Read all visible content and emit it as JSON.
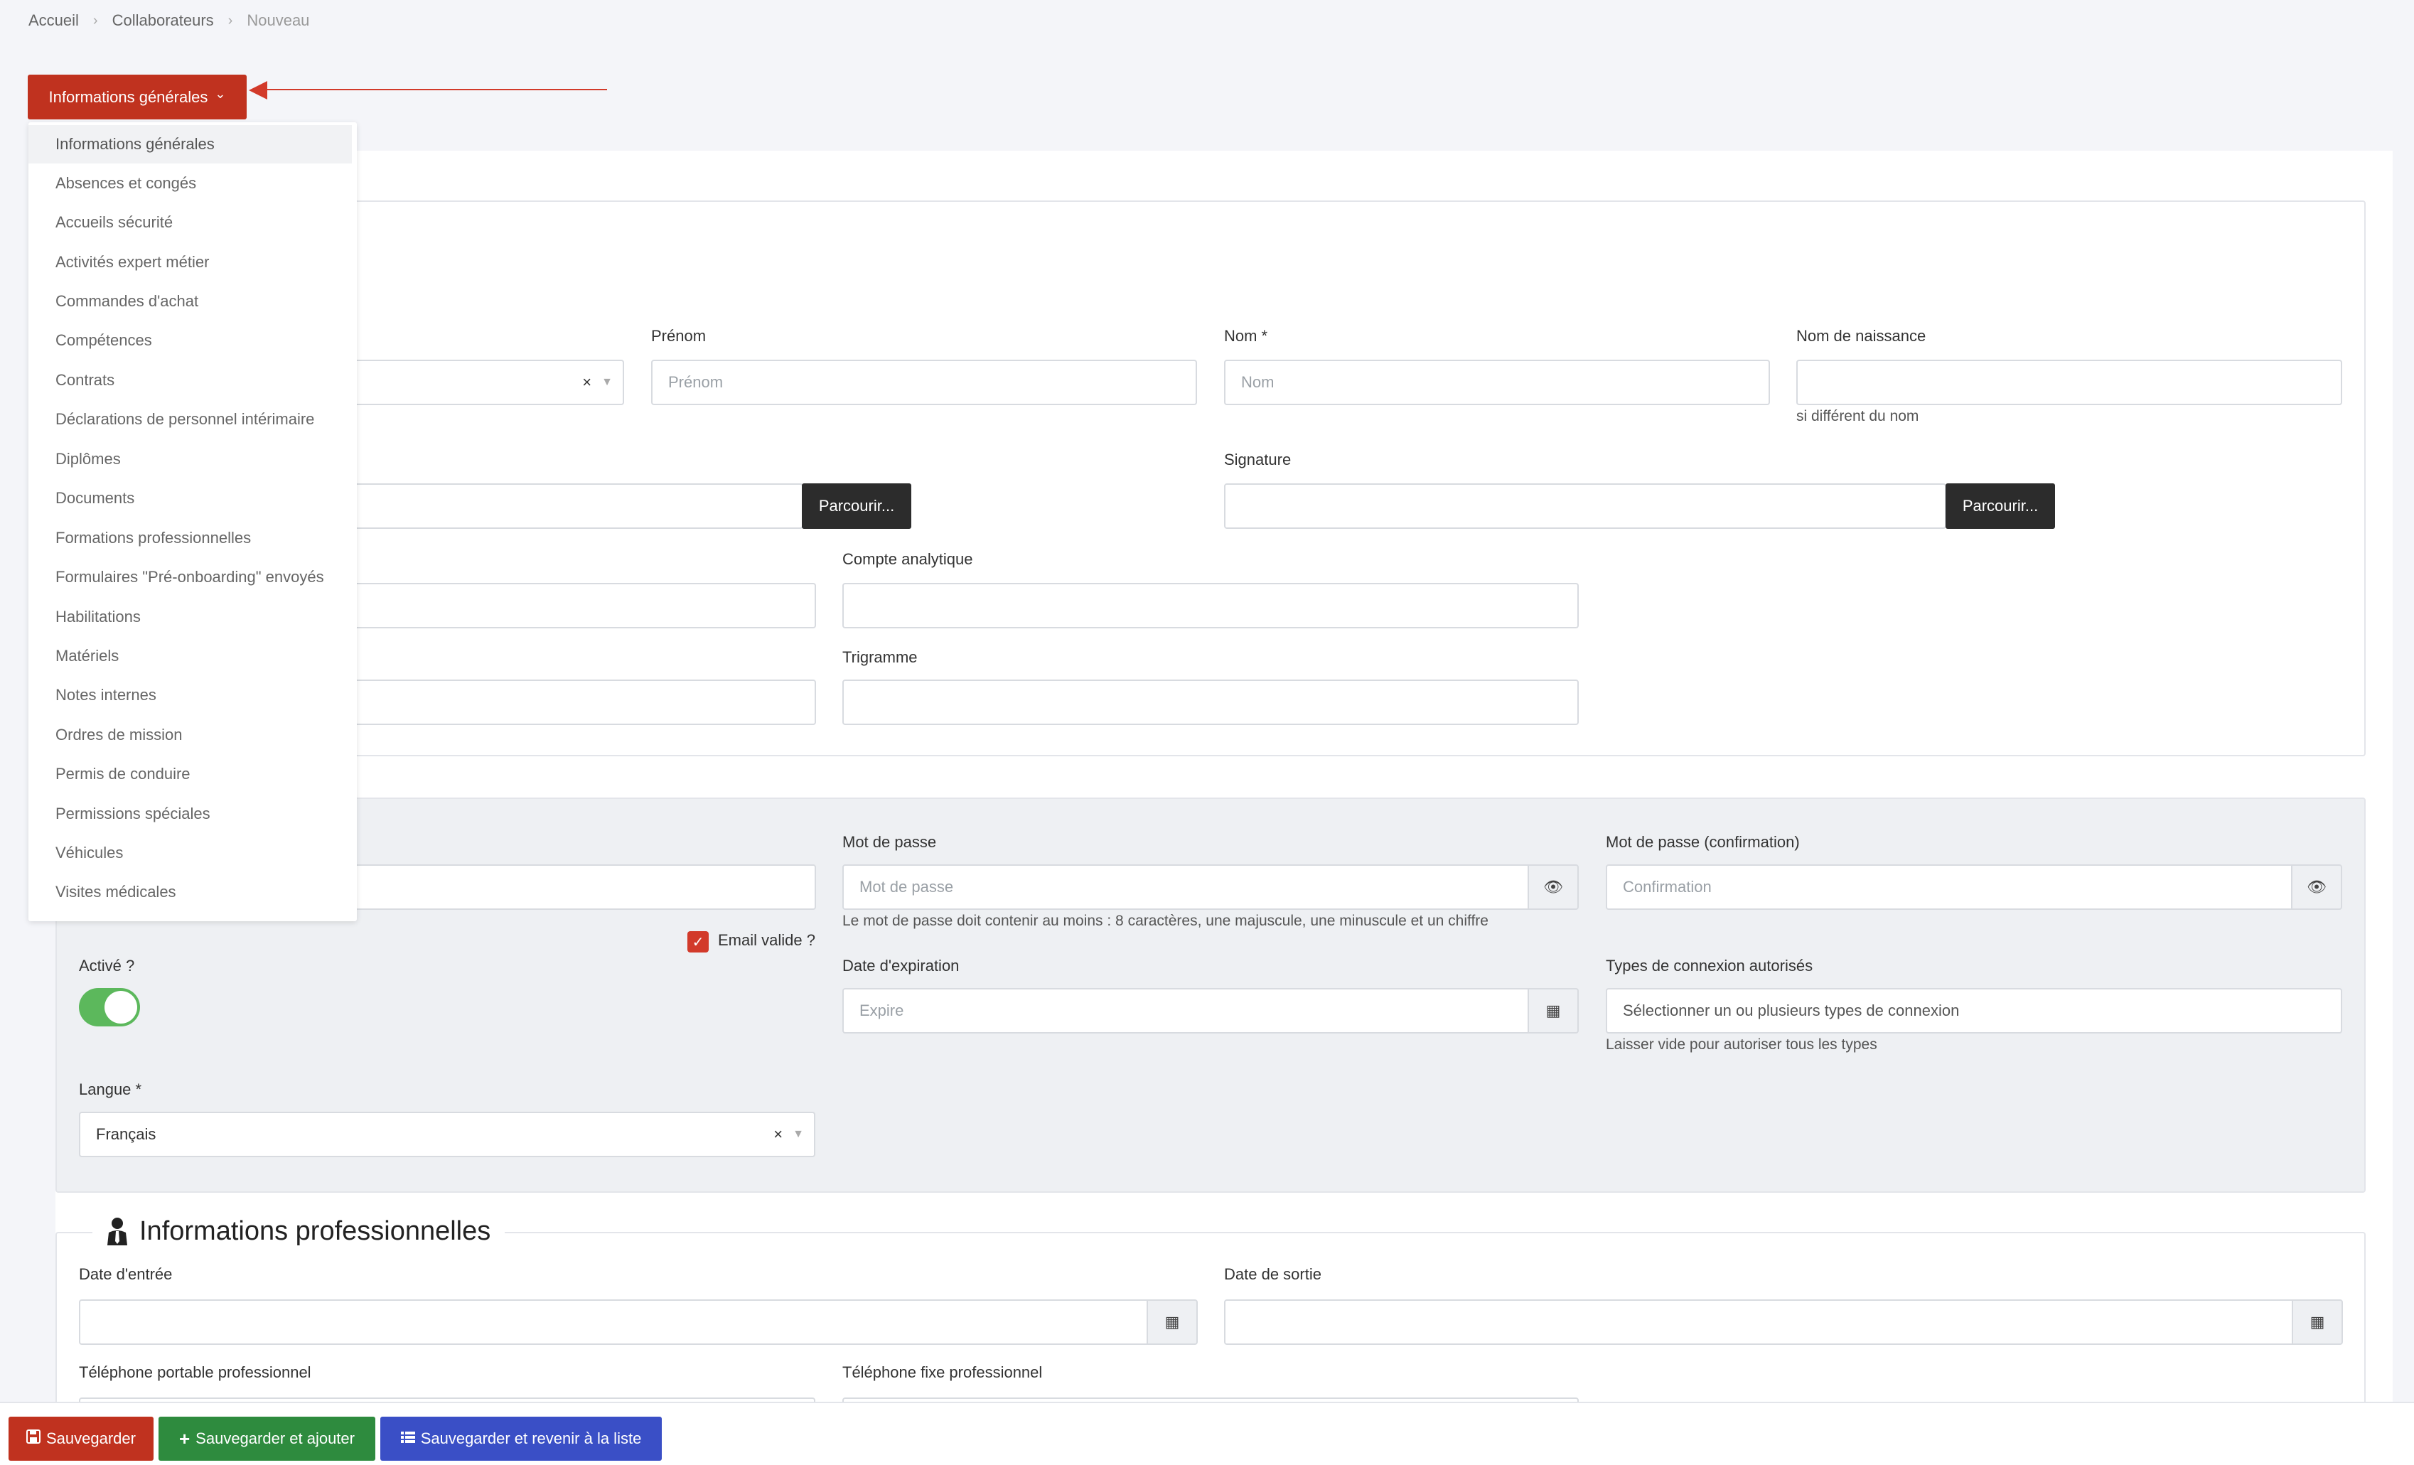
{
  "breadcrumb": {
    "items": [
      "Accueil",
      "Collaborateurs",
      "Nouveau"
    ],
    "separator": "›"
  },
  "tab_selector": {
    "label": "Informations générales",
    "chevron": "⌄"
  },
  "dropdown": {
    "items": [
      "Informations générales",
      "Absences et congés",
      "Accueils sécurité",
      "Activités expert métier",
      "Commandes d'achat",
      "Compétences",
      "Contrats",
      "Déclarations de personnel intérimaire",
      "Diplômes",
      "Documents",
      "Formations professionnelles",
      "Formulaires \"Pré-onboarding\" envoyés",
      "Habilitations",
      "Matériels",
      "Notes internes",
      "Ordres de mission",
      "Permis de conduire",
      "Permissions spéciales",
      "Véhicules",
      "Visites médicales"
    ]
  },
  "identity": {
    "prenom_label": "Prénom",
    "prenom_placeholder": "Prénom",
    "nom_label": "Nom *",
    "nom_placeholder": "Nom",
    "nom_naissance_label": "Nom de naissance",
    "nom_naissance_hint": "si différent du nom",
    "select_clear": "×",
    "browse_label": "Parcourir...",
    "signature_label": "Signature",
    "compte_label": "Compte analytique",
    "trigramme_label": "Trigramme"
  },
  "account": {
    "mdp_label": "Mot de passe",
    "mdp_placeholder": "Mot de passe",
    "mdp_hint": "Le mot de passe doit contenir au moins : 8 caractères, une majuscule, une minuscule et un chiffre",
    "mdp_conf_label": "Mot de passe (confirmation)",
    "mdp_conf_placeholder": "Confirmation",
    "email_valid_label": "Email valide ?",
    "check_mark": "✓",
    "active_label": "Activé ?",
    "expiration_label": "Date d'expiration",
    "expiration_placeholder": "Expire",
    "connexion_label": "Types de connexion autorisés",
    "connexion_placeholder": "Sélectionner un ou plusieurs types de connexion",
    "connexion_hint": "Laisser vide pour autoriser tous les types",
    "langue_label": "Langue *",
    "langue_value": "Français",
    "eye_glyph": "👁",
    "calendar_glyph": "▦"
  },
  "pro": {
    "title": "Informations professionnelles",
    "date_entree_label": "Date d'entrée",
    "date_sortie_label": "Date de sortie",
    "tel_portable_label": "Téléphone portable professionnel",
    "tel_fixe_label": "Téléphone fixe professionnel"
  },
  "footer": {
    "save": "Sauvegarder",
    "save_add": "Sauvegarder et ajouter",
    "save_back": "Sauvegarder et revenir à la liste"
  },
  "colors": {
    "primary_red": "#c0321f",
    "green": "#2e8b3e",
    "blue": "#3a4fc6",
    "toggle_green": "#5cb85c"
  }
}
